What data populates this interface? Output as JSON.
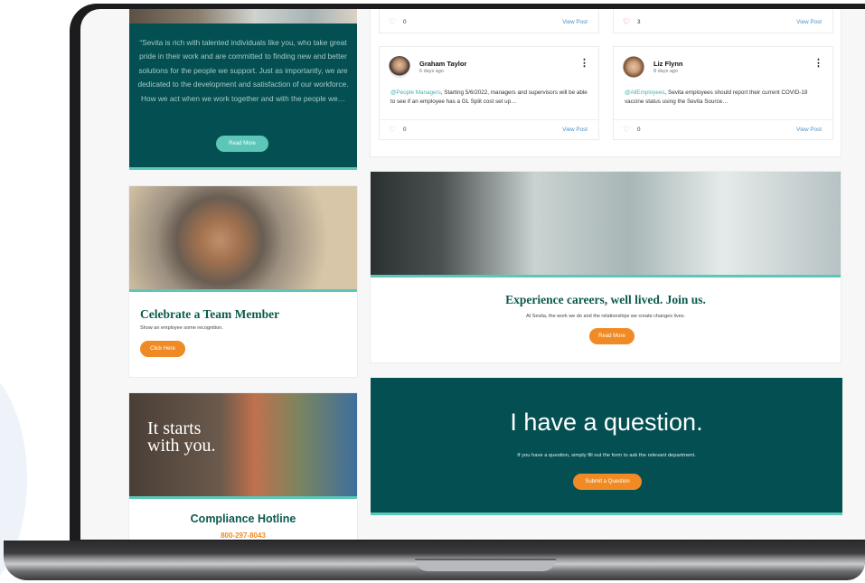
{
  "quote_card": {
    "text": "“Sevita is rich with talented individuals like you, who take great pride in their work and are committed to finding new and better solutions for the people we support. Just as importantly, we are dedicated to the development and satisfaction of our workforce. How we act when we work together and with the people we…",
    "button": "Read More"
  },
  "feed": {
    "top_posts": [
      {
        "likes": "0",
        "liked": false,
        "view": "View Post"
      },
      {
        "likes": "3",
        "liked": true,
        "view": "View Post"
      }
    ],
    "posts": [
      {
        "author": "Graham Taylor",
        "ago": "6 days ago",
        "mention": "@People Managers",
        "text": ", Starting 5/6/2022, managers and supervisors will be able to see if an employee has a GL Split cost set up…",
        "likes": "0",
        "view": "View Post"
      },
      {
        "author": "Liz Flynn",
        "ago": "8 days ago",
        "mention": "@AllEmployees",
        "text": ", Sevita employees should report their current COVID-19 vaccine status using the Sevita Source…",
        "likes": "0",
        "view": "View Post"
      }
    ]
  },
  "celebrate": {
    "title": "Celebrate a Team Member",
    "subtitle": "Show an employee some recognition.",
    "button": "Click Here"
  },
  "careers": {
    "title": "Experience careers, well lived. Join us.",
    "subtitle": "At Sevita, the work we do and the relationships we create changes lives.",
    "button": "Read More"
  },
  "question": {
    "title": "I have a question.",
    "subtitle": "If you have a question, simply fill out the form to ask the relevant department.",
    "button": "Submit a Question"
  },
  "compliance": {
    "overlay_line1": "It starts",
    "overlay_line2": "with you.",
    "title": "Compliance Hotline",
    "phone": "800-297-8043"
  },
  "colors": {
    "teal_dark": "#034f52",
    "teal_accent": "#5cc7b8",
    "orange": "#f08a24",
    "link_blue": "#4a90c8"
  }
}
